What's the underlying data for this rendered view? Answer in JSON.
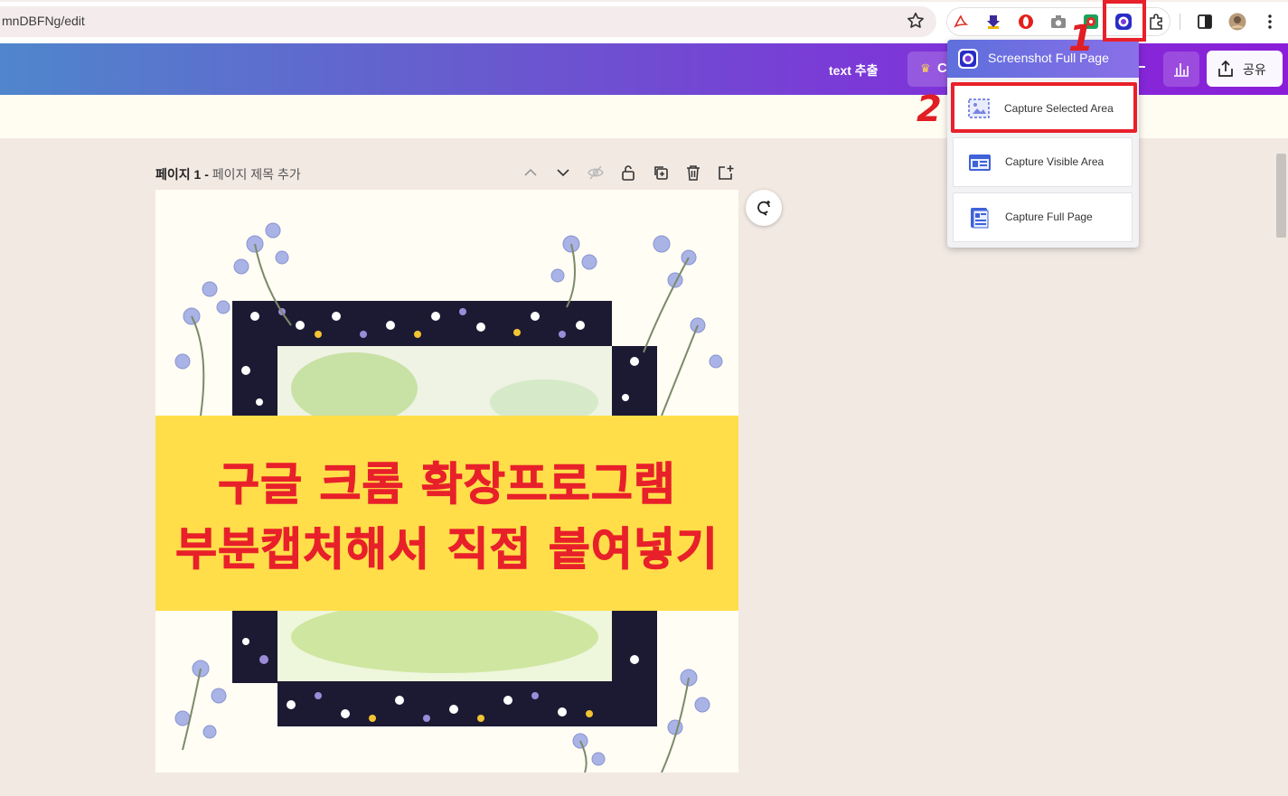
{
  "browser": {
    "url": "mnDBFNg/edit",
    "bookmark_icon": "star-icon",
    "toolbar_icons": [
      "acrobat-icon",
      "download-arrow-icon",
      "opera-icon",
      "camera-icon",
      "record-icon",
      "screenshot-extension-icon",
      "puzzle-extensions-icon",
      "side-panel-icon",
      "profile-avatar",
      "menu-dots-icon"
    ]
  },
  "annotations": {
    "step1": "1",
    "step2": "2",
    "highlight_color": "#e8202a"
  },
  "app_header": {
    "text_extract_label": "text 추출",
    "premium_label": "C",
    "share_label": "공유",
    "gradient_start": "#4f86cc",
    "gradient_end": "#8a1ed8"
  },
  "page": {
    "page_number_label": "페이지 1 - ",
    "page_title_placeholder": "페이지 제목 추가"
  },
  "canvas": {
    "banner_line1": "구글 크롬 확장프로그램",
    "banner_line2": "부분캡처해서 직접 붙여넣기",
    "banner_color": "#ffde4a",
    "text_color": "#e8202a"
  },
  "popup": {
    "title": "Screenshot Full Page",
    "items": [
      {
        "label": "Capture Selected Area",
        "icon": "select-area-icon",
        "selected": true
      },
      {
        "label": "Capture Visible Area",
        "icon": "visible-area-icon",
        "selected": false
      },
      {
        "label": "Capture Full Page",
        "icon": "full-page-icon",
        "selected": false
      }
    ]
  }
}
